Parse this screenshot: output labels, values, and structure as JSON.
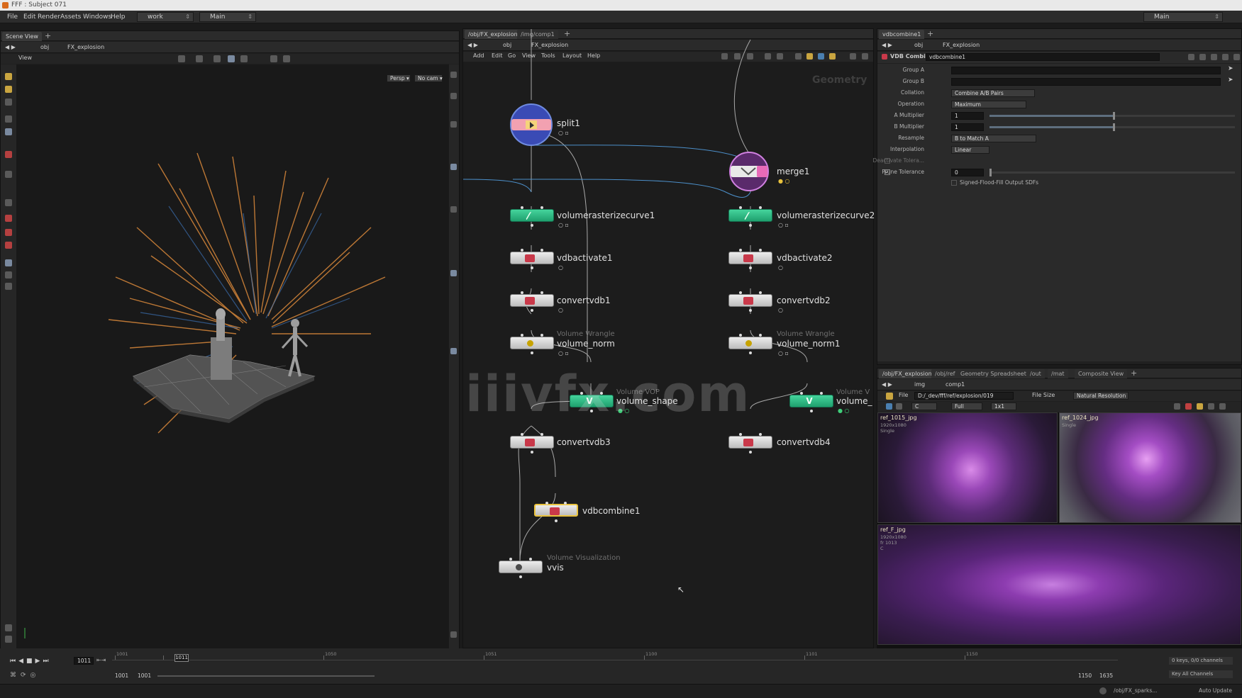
{
  "window": {
    "title": "FFF : Subject 071"
  },
  "menubar": {
    "items": [
      "File",
      "Edit",
      "Render",
      "Assets",
      "Windows",
      "Help"
    ],
    "desktop": "work",
    "context": "Main",
    "right_context": "Main"
  },
  "scene_view": {
    "tab": "Scene View",
    "path": {
      "root": "obj",
      "node": "FX_explosion"
    },
    "view_label": "View",
    "persp": "Persp ▾",
    "cam": "No cam ▾"
  },
  "network": {
    "tabs": [
      "/obj/FX_explosion",
      "/img/comp1"
    ],
    "path": {
      "root": "obj",
      "node": "FX_explosion"
    },
    "menu": [
      "Add",
      "Edit",
      "Go",
      "View",
      "Tools",
      "Layout",
      "Help"
    ],
    "context_label": "Geometry",
    "nodes": {
      "split1": "split1",
      "merge1": "merge1",
      "vrc1": "volumerasterizecurve1",
      "vrc2": "volumerasterizecurve2",
      "vdbact1": "vdbactivate1",
      "vdbact2": "vdbactivate2",
      "convvdb1": "convertvdb1",
      "convvdb2": "convertvdb2",
      "vnorm_sub": "Volume Wrangle",
      "vnorm": "volume_norm",
      "vnorm1_sub": "Volume Wrangle",
      "vnorm1": "volume_norm1",
      "vshape_sub": "Volume VOP",
      "vshape": "volume_shape",
      "vshape2_sub": "Volume V",
      "vshape2": "volume_",
      "convvdb3": "convertvdb3",
      "convvdb4": "convertvdb4",
      "vdbcombine1": "vdbcombine1",
      "vvis_sub": "Volume Visualization",
      "vvis": "vvis"
    }
  },
  "watermark": "iiivfx.com",
  "params": {
    "tab": "vdbcombine1",
    "path": {
      "root": "obj",
      "node": "FX_explosion"
    },
    "type": "VDB Combine",
    "name": "vdbcombine1",
    "rows": {
      "group_a": "Group A",
      "group_b": "Group B",
      "collation": "Collation",
      "collation_value": "Combine A/B Pairs",
      "operation": "Operation",
      "operation_value": "Maximum",
      "a_mult": "A Multiplier",
      "a_mult_value": "1",
      "b_mult": "B Multiplier",
      "b_mult_value": "1",
      "resample": "Resample",
      "resample_value": "B to Match A",
      "interp": "Interpolation",
      "interp_value": "Linear",
      "deact_tol": "Deactivate Tolera...",
      "prune_tol": "Prune Tolerance",
      "prune_tol_value": "0",
      "sdf": "Signed-Flood-Fill Output SDFs"
    }
  },
  "image_viewer": {
    "tabs": [
      "/obj/FX_explosion",
      "/obj/ref",
      "Geometry Spreadsheet",
      "/out",
      "/mat",
      "Composite View"
    ],
    "path": {
      "root": "img",
      "node": "comp1"
    },
    "file_label": "File",
    "file_path": "D:/_dev/fff/ref/explosion/019",
    "file_size": "File Size",
    "resolution": "Natural Resolution",
    "full": "Full",
    "zoom": "1x1",
    "channel": "C",
    "tiles": [
      {
        "name": "ref_1015_jpg",
        "meta": "1920x1080\nSingle"
      },
      {
        "name": "ref_1024_jpg",
        "meta": "Single"
      },
      {
        "name": "ref_F_jpg",
        "meta": "1920x1080\nfr 1013\nC"
      }
    ]
  },
  "timeline": {
    "current_frame": "1011",
    "marker_frame": "1011",
    "ticks": [
      "1001",
      "1050",
      "1051",
      "1100",
      "1101",
      "1150"
    ],
    "start": "1001",
    "start2": "1001",
    "end": "1150",
    "end2": "1635",
    "keys": "0 keys, 0/0 channels",
    "key_all": "Key All Channels"
  },
  "status": {
    "path": "/obj/FX_sparks...",
    "update": "Auto Update"
  },
  "colors": {
    "green_node": "#2fbf83",
    "selected_yellow": "#e9c23d",
    "bg_dark": "#1b1b1b",
    "smoke_purple": "#6b2d8e"
  }
}
